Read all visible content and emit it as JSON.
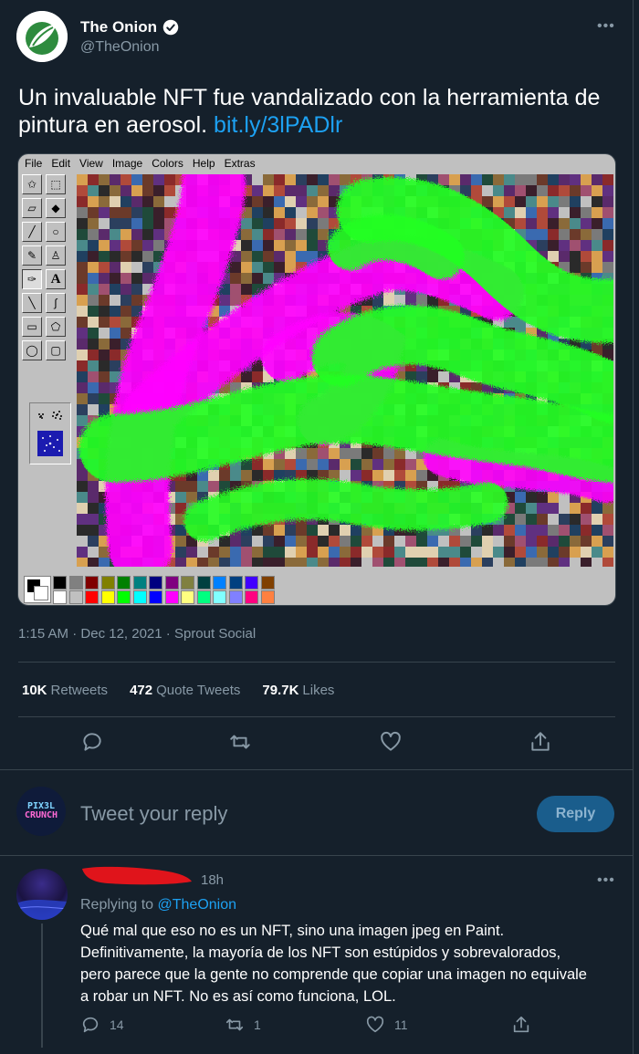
{
  "tweet": {
    "author_name": "The Onion",
    "author_handle": "@TheOnion",
    "text": "Un invaluable NFT fue vandalizado con la herramienta de pintura en aerosol.",
    "link_text": "bit.ly/3lPADlr",
    "time": "1:15 AM",
    "date": "Dec 12, 2021",
    "source": "Sprout Social",
    "meta_sep": "·",
    "more_icon": "more-icon",
    "verified_icon": "verified-badge-icon"
  },
  "paint": {
    "menu": [
      "File",
      "Edit",
      "View",
      "Image",
      "Colors",
      "Help",
      "Extras"
    ],
    "palette_top": [
      "#000000",
      "#808080",
      "#800000",
      "#808000",
      "#008000",
      "#008080",
      "#000080",
      "#800080",
      "#808040",
      "#004040",
      "#0080ff",
      "#004080",
      "#4000ff",
      "#804000"
    ],
    "palette_bottom": [
      "#ffffff",
      "#c0c0c0",
      "#ff0000",
      "#ffff00",
      "#00ff00",
      "#00ffff",
      "#0000ff",
      "#ff00ff",
      "#ffff80",
      "#00ff80",
      "#80ffff",
      "#8080ff",
      "#ff0080",
      "#ff8040"
    ],
    "spray_colors": [
      "#ff00ff",
      "#22ff22"
    ]
  },
  "stats": {
    "retweets_count": "10K",
    "retweets_label": "Retweets",
    "quotes_count": "472",
    "quotes_label": "Quote Tweets",
    "likes_count": "79.7K",
    "likes_label": "Likes"
  },
  "composer": {
    "avatar_line1": "PIX3L",
    "avatar_line2": "CRUNCH",
    "placeholder": "Tweet your reply",
    "button": "Reply"
  },
  "reply": {
    "time": "18h",
    "replying_prefix": "Replying to",
    "replying_handle": "@TheOnion",
    "text": "Qué mal que eso no es un NFT, sino una imagen jpeg en Paint. Definitivamente, la mayoría de los NFT son estúpidos y sobrevalorados, pero parece que la gente no comprende que copiar una imagen no equivale a robar un NFT. No es así como funciona, LOL.",
    "reply_count": "14",
    "retweet_count": "1",
    "like_count": "11"
  }
}
